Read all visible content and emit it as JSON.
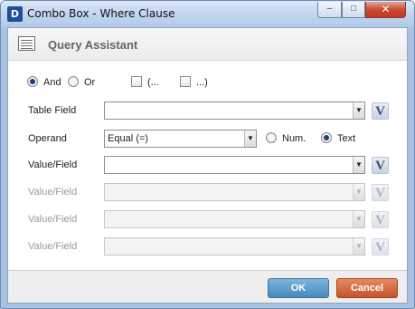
{
  "window": {
    "title": "Combo Box - Where Clause",
    "app_icon_text": "D",
    "controls": {
      "minimize": "–",
      "maximize": "□",
      "close": "✕"
    }
  },
  "header": {
    "title": "Query Assistant"
  },
  "logic": {
    "and_label": "And",
    "or_label": "Or",
    "selected": "And",
    "open_paren_label": "(...",
    "close_paren_label": "...)"
  },
  "rows": {
    "table_field": {
      "label": "Table Field",
      "value": ""
    },
    "operand": {
      "label": "Operand",
      "value": "Equal (=)",
      "num_label": "Num.",
      "text_label": "Text",
      "selected_type": "Text"
    },
    "value_field_1": {
      "label": "Value/Field",
      "value": ""
    },
    "value_field_2": {
      "label": "Value/Field",
      "value": ""
    },
    "value_field_3": {
      "label": "Value/Field",
      "value": ""
    },
    "value_field_4": {
      "label": "Value/Field",
      "value": ""
    }
  },
  "v_button_label": "V",
  "dropdown_arrow": "▼",
  "footer": {
    "ok_label": "OK",
    "cancel_label": "Cancel"
  },
  "colors": {
    "ok_button": "#4688bd",
    "cancel_button": "#c4532a",
    "close_button": "#cc4a33"
  }
}
